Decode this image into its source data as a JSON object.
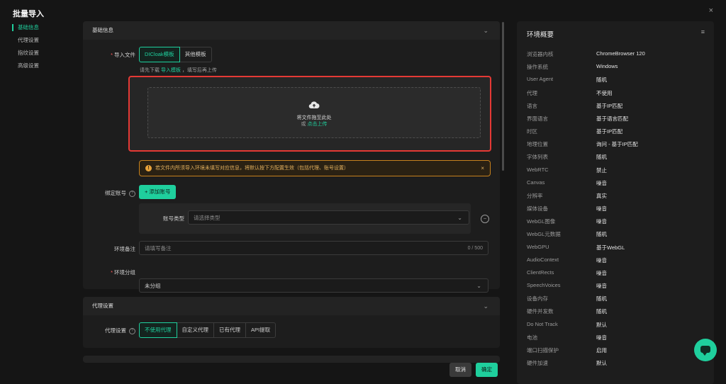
{
  "dialog": {
    "title": "批量导入",
    "close_icon": "×"
  },
  "nav": {
    "items": [
      {
        "label": "基础信息",
        "active": true
      },
      {
        "label": "代理设置",
        "active": false
      },
      {
        "label": "指纹设置",
        "active": false
      },
      {
        "label": "高级设置",
        "active": false
      }
    ]
  },
  "basic": {
    "header": "基础信息",
    "import_label": "导入文件",
    "tabs": [
      "DICloak模板",
      "其他模板"
    ],
    "hint_prefix": "请先下载",
    "hint_link": "导入模板",
    "hint_suffix": "，填写后再上传",
    "upload_text": "将文件拖至此处",
    "upload_or": "或",
    "upload_link": "点击上传",
    "warning": "若文件内所须导入环境未填写对应信息，将默认按下方配置生效（包括代理、账号设置）",
    "bind_label": "绑定账号",
    "add_account": "+ 添加账号",
    "account_type_label": "账号类型",
    "account_type_placeholder": "请选择类型",
    "remark_label": "环境备注",
    "remark_placeholder": "请填写备注",
    "remark_count": "0 / 500",
    "group_label": "环境分组",
    "group_value": "未分组"
  },
  "proxy": {
    "header": "代理设置",
    "label": "代理设置",
    "tabs": [
      "不使用代理",
      "自定义代理",
      "已有代理",
      "API提取"
    ]
  },
  "summary": {
    "title": "环境概要",
    "rows": [
      {
        "k": "浏览器内核",
        "v": "ChromeBrowser 120"
      },
      {
        "k": "操作系统",
        "v": "Windows"
      },
      {
        "k": "User Agent",
        "v": "随机"
      },
      {
        "k": "代理",
        "v": "不使用"
      },
      {
        "k": "语言",
        "v": "基于IP匹配"
      },
      {
        "k": "界面语言",
        "v": "基于语言匹配"
      },
      {
        "k": "时区",
        "v": "基于IP匹配"
      },
      {
        "k": "地理位置",
        "v": "询问 - 基于IP匹配"
      },
      {
        "k": "字体列表",
        "v": "随机"
      },
      {
        "k": "WebRTC",
        "v": "禁止"
      },
      {
        "k": "Canvas",
        "v": "噪音"
      },
      {
        "k": "分辨率",
        "v": "真实"
      },
      {
        "k": "媒体设备",
        "v": "噪音"
      },
      {
        "k": "WebGL图像",
        "v": "噪音"
      },
      {
        "k": "WebGL元数据",
        "v": "随机"
      },
      {
        "k": "WebGPU",
        "v": "基于WebGL"
      },
      {
        "k": "AudioContext",
        "v": "噪音"
      },
      {
        "k": "ClientRects",
        "v": "噪音"
      },
      {
        "k": "SpeechVoices",
        "v": "噪音"
      },
      {
        "k": "设备内存",
        "v": "随机"
      },
      {
        "k": "硬件并发数",
        "v": "随机"
      },
      {
        "k": "Do Not Track",
        "v": "默认"
      },
      {
        "k": "电池",
        "v": "噪音"
      },
      {
        "k": "端口扫描保护",
        "v": "启用"
      },
      {
        "k": "硬件加速",
        "v": "默认"
      }
    ]
  },
  "footer": {
    "cancel": "取消",
    "confirm": "确定"
  },
  "colors": {
    "accent": "#1fcf9d",
    "warning": "#e8a23a",
    "highlight_border": "#e53935",
    "background": "#151515"
  },
  "icons": {
    "close": "close-icon",
    "upload": "cloud-upload-icon",
    "warning": "warning-icon",
    "chevron": "chevron-down-icon",
    "menu": "list-menu-icon",
    "chat": "chat-icon",
    "help": "help-icon",
    "minus": "remove-circle-icon"
  }
}
